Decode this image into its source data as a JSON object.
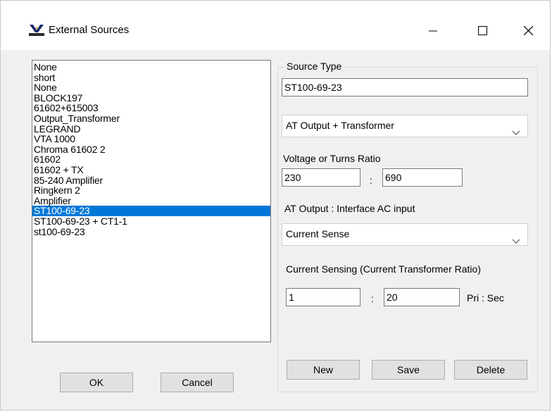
{
  "window": {
    "title": "External Sources",
    "icon": "app-logo-icon"
  },
  "titlebar_buttons": {
    "minimize": "minimize-icon",
    "maximize": "maximize-icon",
    "close": "close-icon"
  },
  "sources": [
    "None",
    "short",
    "None",
    "BLOCK197",
    "61602+615003",
    "Output_Transformer",
    "LEGRAND",
    "VTA 1000",
    "Chroma 61602 2",
    "61602",
    "61602 + TX",
    "85-240 Amplifier",
    "Ringkern 2",
    "Amplifier",
    "ST100-69-23",
    "ST100-69-23 + CT1-1",
    "st100-69-23"
  ],
  "selected_index": 14,
  "buttons": {
    "ok": "OK",
    "cancel": "Cancel",
    "new": "New",
    "save": "Save",
    "delete": "Delete"
  },
  "source_type": {
    "legend": "Source Type",
    "name_value": "ST100-69-23",
    "type_selected": "AT Output + Transformer"
  },
  "ratio": {
    "label": "Voltage or Turns Ratio",
    "left": "230",
    "separator": ":",
    "right": "690"
  },
  "interface": {
    "label": "AT Output : Interface AC input",
    "selected": "Current Sense"
  },
  "current_sensing": {
    "label": "Current Sensing (Current Transformer Ratio)",
    "left": "1",
    "separator": ":",
    "right": "20",
    "unit": "Pri : Sec"
  },
  "colors": {
    "selection": "#0078d7",
    "background": "#f0f0f0"
  }
}
